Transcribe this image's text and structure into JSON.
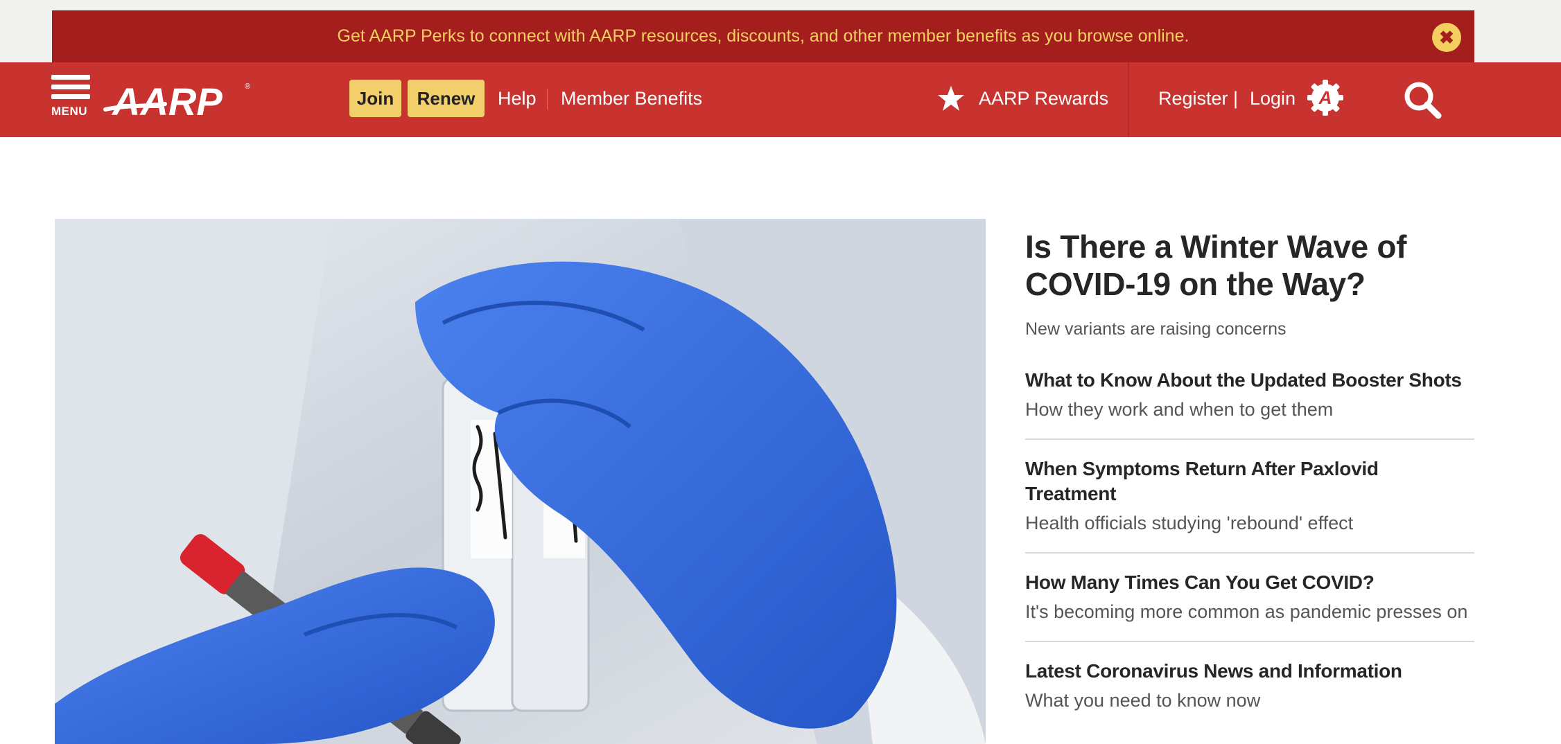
{
  "perks_banner": {
    "message": "Get AARP Perks to connect with AARP resources, discounts, and other member benefits as you browse online.",
    "close_icon": "close-icon"
  },
  "nav": {
    "menu_label": "MENU",
    "logo_text": "AARP",
    "join_label": "Join",
    "renew_label": "Renew",
    "help_label": "Help",
    "member_benefits_label": "Member Benefits",
    "rewards_label": "AARP Rewards",
    "register_label": "Register",
    "pipe": "|",
    "login_label": "Login",
    "icons": [
      "hamburger-icon",
      "star-icon",
      "account-icon",
      "search-icon"
    ]
  },
  "colors": {
    "banner_bg": "#a41e1e",
    "banner_text": "#f3cf5f",
    "nav_bg": "#c8332f",
    "button_yellow": "#f3cf6c",
    "glove_blue": "#3a6fe0"
  },
  "main": {
    "headline": "Is There a Winter Wave of COVID-19 on the Way?",
    "subhead": "New variants are raising concerns",
    "stories": [
      {
        "title": "What to Know About the Updated Booster Shots",
        "subtitle": "How they work and when to get them"
      },
      {
        "title": "When Symptoms Return After Paxlovid Treatment",
        "subtitle": "Health officials studying 'rebound' effect"
      },
      {
        "title": "How Many Times Can You Get COVID?",
        "subtitle": "It's becoming more common as pandemic presses on"
      },
      {
        "title": "Latest Coronavirus News and Information",
        "subtitle": "What you need to know now"
      }
    ]
  }
}
